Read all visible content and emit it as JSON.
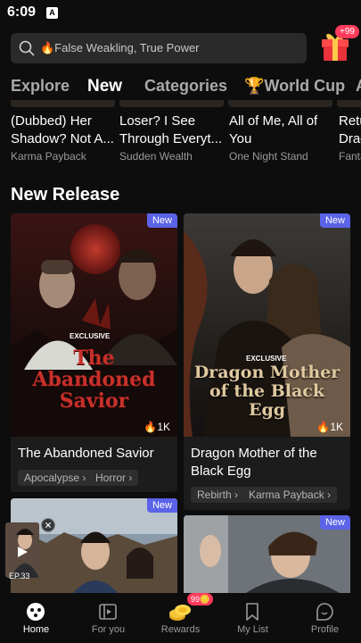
{
  "status": {
    "time": "6:09",
    "indicator": "A"
  },
  "search": {
    "placeholder": "🔥False Weakling, True Power"
  },
  "gift": {
    "badge": "+99"
  },
  "tabs": [
    {
      "label": "Explore"
    },
    {
      "label": "New"
    },
    {
      "label": "Categories"
    },
    {
      "label": "🏆World Cup"
    },
    {
      "label": "A"
    }
  ],
  "previous_row": [
    {
      "title": "(Dubbed) Her Shadow? Not A...",
      "tag": "Karma Payback"
    },
    {
      "title": "Loser? I See Through Everyt...",
      "tag": "Sudden Wealth"
    },
    {
      "title": "All of Me, All of You",
      "tag": "One Night Stand"
    },
    {
      "title": "Retu Drag",
      "tag": "Fanta"
    }
  ],
  "section": {
    "title": "New Release"
  },
  "cards": [
    {
      "badge": "New",
      "poster_title": "The Abandoned Savior",
      "exclusive": "EXCLUSIVE",
      "views": "1K",
      "title": "The Abandoned Savior",
      "tags": [
        "Apocalypse",
        "Horror"
      ]
    },
    {
      "badge": "New",
      "poster_title": "Dragon Mother of the Black Egg",
      "exclusive": "EXCLUSIVE",
      "views": "1K",
      "title": "Dragon Mother of the Black Egg",
      "tags": [
        "Rebirth",
        "Karma Payback"
      ]
    },
    {
      "badge": "New"
    },
    {
      "badge": "New"
    }
  ],
  "mini_player": {
    "episode": "EP.33"
  },
  "nav": {
    "rewards_badge": "99",
    "items": [
      {
        "label": "Home",
        "icon": "home-icon"
      },
      {
        "label": "For you",
        "icon": "for-you-icon"
      },
      {
        "label": "Rewards",
        "icon": "rewards-icon"
      },
      {
        "label": "My List",
        "icon": "bookmark-icon"
      },
      {
        "label": "Profile",
        "icon": "profile-icon"
      }
    ]
  },
  "colors": {
    "accent": "#5b63e8",
    "badge": "#ff3b5c",
    "background": "#0d0d0d"
  }
}
